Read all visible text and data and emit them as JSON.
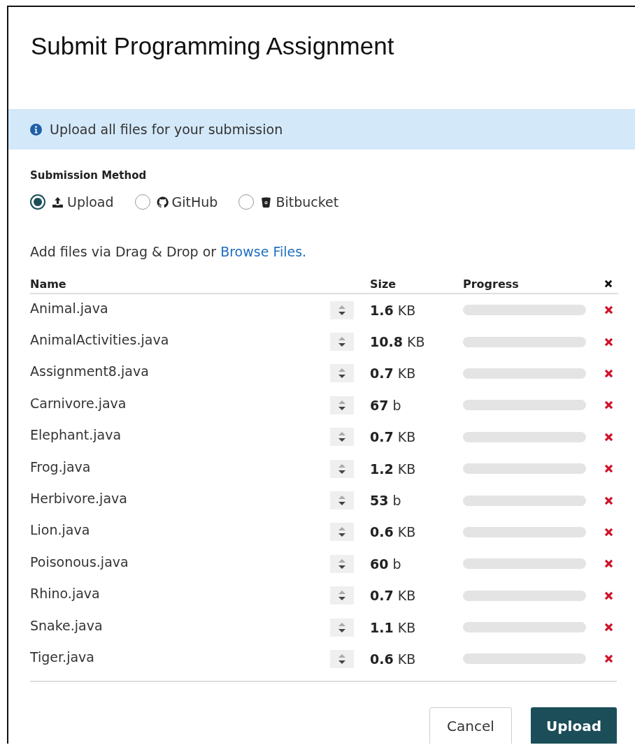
{
  "dialog": {
    "title": "Submit Programming Assignment"
  },
  "notice": {
    "text": "Upload all files for your submission"
  },
  "submission_method": {
    "label": "Submission Method",
    "options": [
      {
        "label": "Upload",
        "selected": true
      },
      {
        "label": "GitHub",
        "selected": false
      },
      {
        "label": "Bitbucket",
        "selected": false
      }
    ]
  },
  "add_files": {
    "text": "Add files via Drag & Drop or",
    "link": "Browse Files."
  },
  "table": {
    "columns": [
      "Name",
      "Size",
      "Progress"
    ],
    "rows": [
      {
        "name": "Animal.java",
        "size": "**1.6** KB",
        "level": 0
      },
      {
        "name": "AnimalActivities.java",
        "size": "**10.8** KB",
        "level": 0
      },
      {
        "name": "Assignment8.java",
        "size": "**0.7** KB",
        "level": 0
      },
      {
        "name": "Carnivore.java",
        "size": "**67** b",
        "level": 0
      },
      {
        "name": "Elephant.java",
        "size": "**0.7** KB",
        "level": 0
      },
      {
        "name": "Frog.java",
        "size": "**1.2** KB",
        "level": 0
      },
      {
        "name": "Herbivore.java",
        "size": "**53** b",
        "level": 0
      },
      {
        "name": "Lion.java",
        "size": "**0.6** KB",
        "level": 0
      },
      {
        "name": "Poisonous.java",
        "size": "**60** b",
        "level": 0
      },
      {
        "name": "Rhino.java",
        "size": "**0.7** KB",
        "level": 0
      },
      {
        "name": "Snake.java",
        "size": "**1.1** KB",
        "level": 0
      },
      {
        "name": "Tiger.java",
        "size": "**0.6** KB",
        "level": 0
      }
    ]
  },
  "buttons": [
    {
      "label": "Cancel",
      "kind": "secondary"
    },
    {
      "label": "Upload",
      "kind": "primary"
    }
  ]
}
